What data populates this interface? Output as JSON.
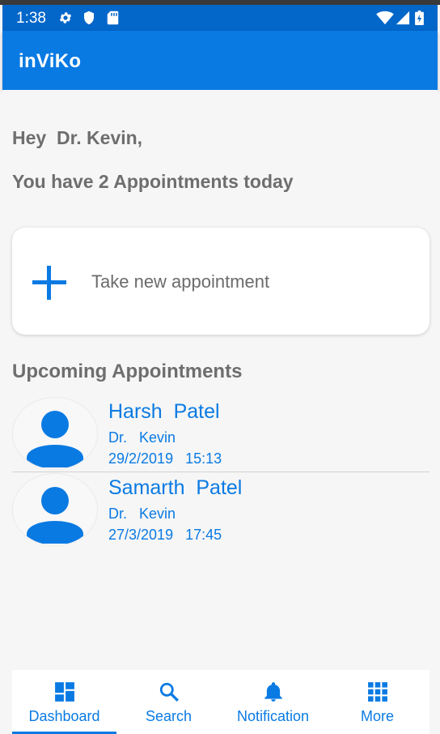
{
  "status_bar": {
    "time": "1:38",
    "icons": [
      "gear-icon",
      "shield-icon",
      "sd-card-icon",
      "wifi-icon",
      "signal-icon",
      "battery-icon"
    ]
  },
  "app_bar": {
    "title": "inViKo"
  },
  "dashboard": {
    "greeting": "Hey  Dr. Kevin,",
    "appointments_today": "You have 2 Appointments today",
    "new_appointment_label": "Take new appointment",
    "upcoming_title": "Upcoming Appointments"
  },
  "appointments": [
    {
      "patient": "Harsh  Patel",
      "doctor": "Dr.   Kevin",
      "datetime": "29/2/2019   15:13"
    },
    {
      "patient": "Samarth  Patel",
      "doctor": "Dr.   Kevin",
      "datetime": "27/3/2019   17:45"
    }
  ],
  "bottom_nav": {
    "items": [
      {
        "label": "Dashboard",
        "icon": "dashboard-icon",
        "active": true
      },
      {
        "label": "Search",
        "icon": "search-icon",
        "active": false
      },
      {
        "label": "Notification",
        "icon": "bell-icon",
        "active": false
      },
      {
        "label": "More",
        "icon": "grid-icon",
        "active": false
      }
    ]
  },
  "colors": {
    "status_bar": "#0366c9",
    "app_bar": "#0a7ae3",
    "accent": "#0a7ae3",
    "text_secondary": "#6e6e6e",
    "background": "#f6f6f6"
  }
}
